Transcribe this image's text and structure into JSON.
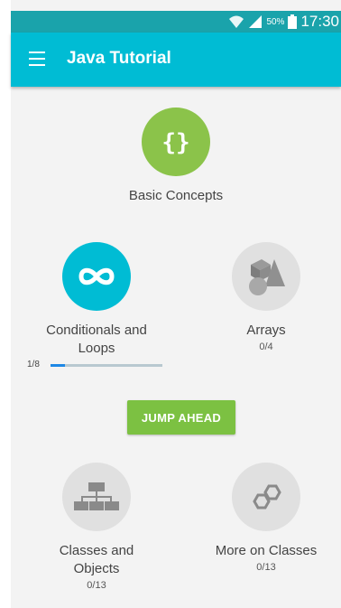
{
  "status_bar": {
    "battery_percent": "50%",
    "time": "17:30",
    "icons": [
      "wifi-icon",
      "signal-icon",
      "battery-icon"
    ]
  },
  "app_bar": {
    "title": "Java Tutorial",
    "menu_icon": "hamburger-menu-icon"
  },
  "lessons": {
    "basic_concepts": {
      "label": "Basic Concepts",
      "icon": "curly-braces-icon",
      "color": "#8bc34a"
    },
    "conditionals": {
      "label_line1": "Conditionals and",
      "label_line2": "Loops",
      "progress_text": "1/8",
      "progress": 0.125,
      "icon": "infinity-icon",
      "color": "#00bcd4"
    },
    "arrays": {
      "label": "Arrays",
      "progress_text": "0/4",
      "icon": "shapes-icon",
      "color": "#e0e0e0"
    },
    "classes_objects": {
      "label_line1": "Classes and",
      "label_line2": "Objects",
      "progress_text": "0/13",
      "icon": "hierarchy-icon",
      "color": "#e0e0e0"
    },
    "more_classes": {
      "label": "More on Classes",
      "progress_text": "0/13",
      "icon": "hexagons-icon",
      "color": "#e0e0e0"
    }
  },
  "jump_button": {
    "label": "JUMP AHEAD",
    "color": "#7cc142"
  }
}
